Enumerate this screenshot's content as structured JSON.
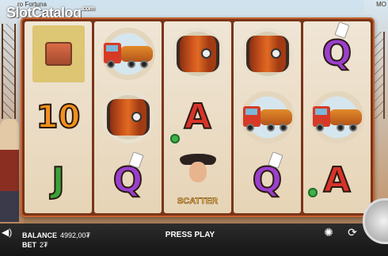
{
  "header": {
    "game_title": "ro Fortuna",
    "mode_label": "MO",
    "watermark": "SlotCatalog",
    "watermark_suffix": ".com"
  },
  "reels": [
    [
      "treasure-chest",
      "10",
      "J"
    ],
    [
      "oil-truck",
      "oil-barrel",
      "Q"
    ],
    [
      "oil-barrel",
      "A",
      "scatter"
    ],
    [
      "oil-barrel",
      "oil-truck",
      "Q"
    ],
    [
      "Q",
      "oil-truck",
      "A"
    ]
  ],
  "symbols": {
    "j": "J",
    "q": "Q",
    "a": "A",
    "ten": "10",
    "scatter_label": "SCATTER"
  },
  "status": {
    "balance_label": "BALANCE",
    "balance_value": "4992,00₮",
    "bet_label": "BET",
    "bet_value": "2₮",
    "prompt": "PRESS PLAY"
  },
  "colors": {
    "frame": "#7a3418",
    "letter_q": "#9b3fcf",
    "letter_a": "#d8332a",
    "letter_j": "#3aa23a",
    "letter_10": "#f2901e"
  },
  "icons": {
    "volume": "speaker-icon",
    "autoplay": "autoplay-icon",
    "spin": "spin-icon"
  }
}
